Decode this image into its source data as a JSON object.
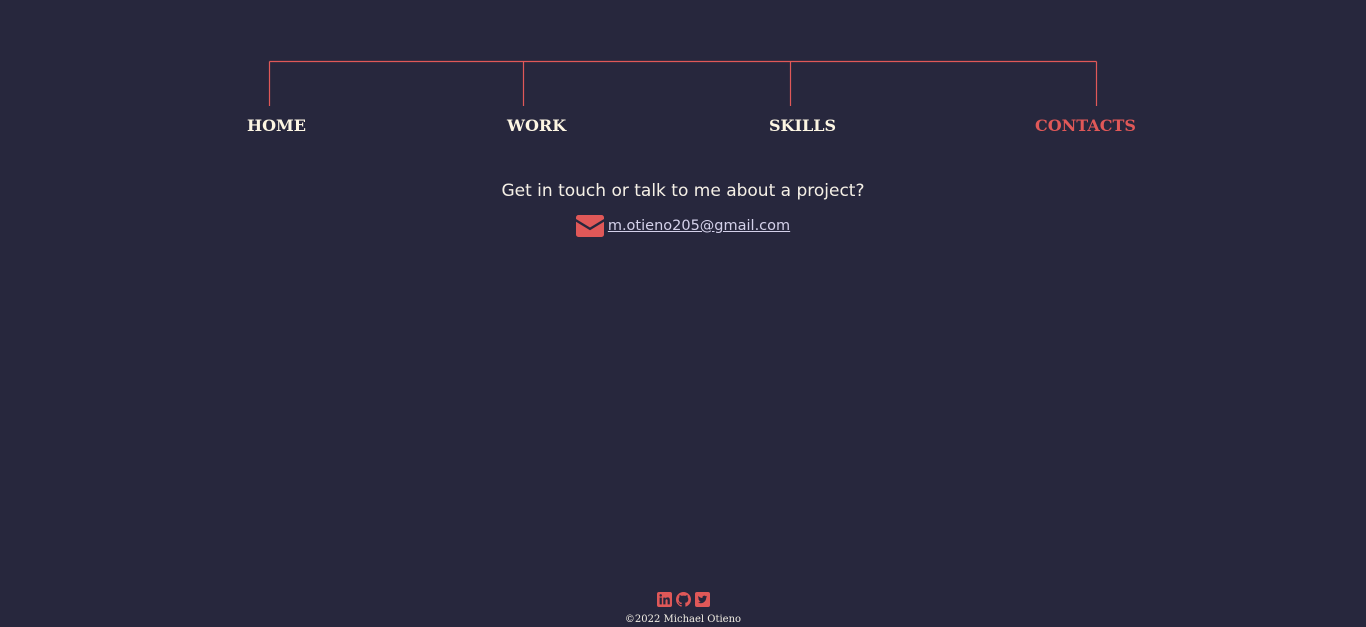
{
  "nav": {
    "items": [
      {
        "label": "HOME",
        "active": false
      },
      {
        "label": "WORK",
        "active": false
      },
      {
        "label": "SKILLS",
        "active": false
      },
      {
        "label": "CONTACTS",
        "active": true
      }
    ]
  },
  "contact": {
    "heading": "Get in touch or talk to me about a project?",
    "email_icon": "envelope-icon",
    "email": "m.otieno205@gmail.com"
  },
  "footer": {
    "social": [
      {
        "icon": "linkedin-icon"
      },
      {
        "icon": "github-icon"
      },
      {
        "icon": "twitter-icon"
      }
    ],
    "copyright": "©2022 Michael Otieno"
  },
  "colors": {
    "background": "#27273d",
    "accent": "#e05858",
    "text": "#fdf6e3"
  }
}
